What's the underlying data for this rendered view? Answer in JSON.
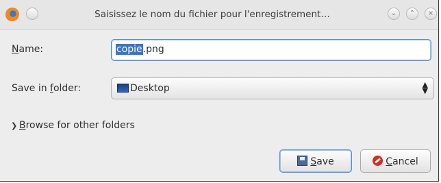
{
  "window": {
    "title": "Saisissez le nom du fichier pour l'enregistrement…",
    "controls": [
      "minimize",
      "maximize",
      "close"
    ]
  },
  "form": {
    "name_label_mnemonic": "N",
    "name_label_rest": "ame:",
    "name_value_selected": "copie",
    "name_value_rest": ".png",
    "folder_label_pre": "Save in ",
    "folder_label_mnemonic": "f",
    "folder_label_rest": "older:",
    "folder_value": "Desktop",
    "browse_pre": "",
    "browse_mnemonic": "B",
    "browse_rest": "rowse for other folders"
  },
  "buttons": {
    "save_mnemonic": "S",
    "save_rest": "ave",
    "cancel_mnemonic": "C",
    "cancel_rest": "ancel"
  },
  "colors": {
    "accent": "#5b8fd0",
    "selection": "#3b73c9",
    "cancel_red": "#d62b1f"
  }
}
